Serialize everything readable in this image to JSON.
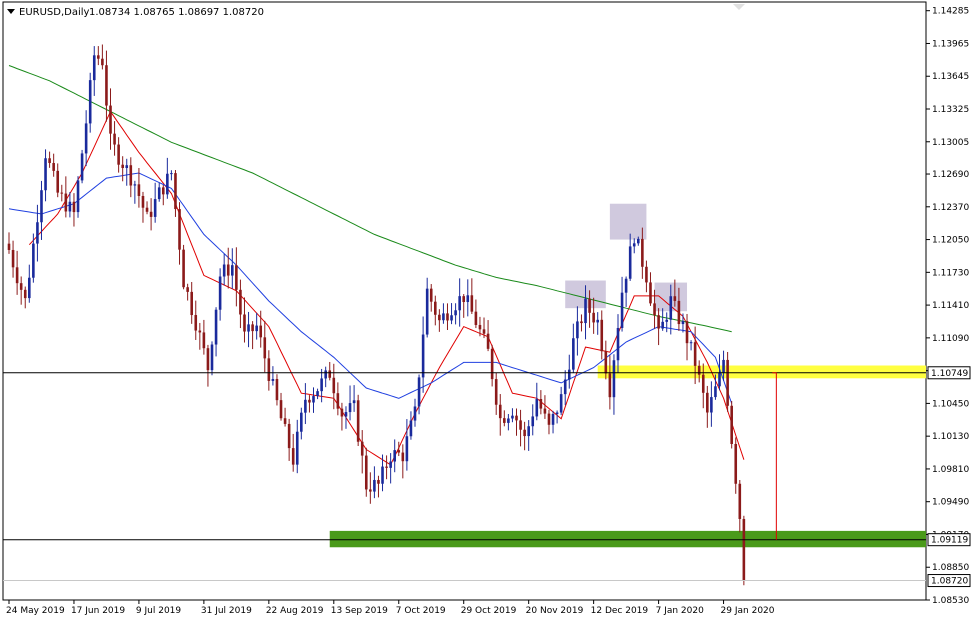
{
  "header": {
    "symbol": "EURUSD,Daily",
    "ohlc": "1.08734 1.08765 1.08697 1.08720"
  },
  "colors": {
    "bull": "#1a2a9c",
    "bear": "#8b1a1a",
    "ma_fast": "#e00000",
    "ma_mid": "#2040e0",
    "ma_slow": "#1a8a1a",
    "support_zone": "#4a9a1a",
    "resistance_zone": "#ffff40",
    "pattern_box": "#c8c0d8",
    "price_tag_bg": "#ffffff"
  },
  "price_tags": {
    "resistance": "1.10749",
    "support": "1.09119",
    "current": "1.08720"
  },
  "chart_data": {
    "type": "candlestick",
    "ylim": [
      1.0853,
      1.1437
    ],
    "y_ticks": [
      "1.14285",
      "1.13965",
      "1.13645",
      "1.13325",
      "1.13005",
      "1.12690",
      "1.12370",
      "1.12050",
      "1.11730",
      "1.11410",
      "1.11090",
      "1.10770",
      "1.10450",
      "1.10130",
      "1.09810",
      "1.09490",
      "1.09170",
      "1.08850",
      "1.08530"
    ],
    "x_labels": [
      "24 May 2019",
      "17 Jun 2019",
      "9 Jul 2019",
      "31 Jul 2019",
      "22 Aug 2019",
      "13 Sep 2019",
      "7 Oct 2019",
      "29 Oct 2019",
      "20 Nov 2019",
      "12 Dec 2019",
      "7 Jan 2020",
      "29 Jan 2020"
    ],
    "x_label_bar_index": [
      0,
      16,
      32,
      48,
      64,
      80,
      96,
      112,
      128,
      144,
      160,
      176
    ],
    "n_bars": 182,
    "close_keyframes": [
      [
        0,
        1.1195
      ],
      [
        4,
        1.1145
      ],
      [
        6,
        1.12
      ],
      [
        9,
        1.129
      ],
      [
        12,
        1.125
      ],
      [
        16,
        1.123
      ],
      [
        19,
        1.132
      ],
      [
        21,
        1.1385
      ],
      [
        23,
        1.138
      ],
      [
        25,
        1.13
      ],
      [
        28,
        1.128
      ],
      [
        31,
        1.126
      ],
      [
        34,
        1.1225
      ],
      [
        37,
        1.125
      ],
      [
        40,
        1.127
      ],
      [
        43,
        1.1165
      ],
      [
        46,
        1.1125
      ],
      [
        49,
        1.108
      ],
      [
        52,
        1.117
      ],
      [
        55,
        1.118
      ],
      [
        58,
        1.111
      ],
      [
        61,
        1.112
      ],
      [
        64,
        1.1075
      ],
      [
        67,
        1.103
      ],
      [
        70,
        1.099
      ],
      [
        73,
        1.105
      ],
      [
        76,
        1.106
      ],
      [
        79,
        1.1075
      ],
      [
        82,
        1.1035
      ],
      [
        85,
        1.104
      ],
      [
        88,
        1.0965
      ],
      [
        91,
        1.0965
      ],
      [
        94,
        1.0995
      ],
      [
        97,
        1.0995
      ],
      [
        100,
        1.1035
      ],
      [
        103,
        1.1155
      ],
      [
        106,
        1.1125
      ],
      [
        109,
        1.114
      ],
      [
        112,
        1.115
      ],
      [
        115,
        1.1125
      ],
      [
        118,
        1.1095
      ],
      [
        121,
        1.103
      ],
      [
        124,
        1.104
      ],
      [
        127,
        1.101
      ],
      [
        130,
        1.105
      ],
      [
        133,
        1.102
      ],
      [
        136,
        1.105
      ],
      [
        139,
        1.1105
      ],
      [
        142,
        1.114
      ],
      [
        145,
        1.1125
      ],
      [
        148,
        1.106
      ],
      [
        151,
        1.1155
      ],
      [
        154,
        1.121
      ],
      [
        157,
        1.117
      ],
      [
        160,
        1.111
      ],
      [
        163,
        1.1145
      ],
      [
        166,
        1.112
      ],
      [
        169,
        1.1085
      ],
      [
        172,
        1.1035
      ],
      [
        175,
        1.107
      ],
      [
        176,
        1.1088
      ],
      [
        178,
        1.101
      ],
      [
        180,
        1.0935
      ],
      [
        181,
        1.0872
      ]
    ],
    "series": [
      {
        "line": "ma_fast",
        "keyframes": [
          [
            5,
            1.12
          ],
          [
            12,
            1.123
          ],
          [
            18,
            1.127
          ],
          [
            25,
            1.133
          ],
          [
            32,
            1.129
          ],
          [
            40,
            1.125
          ],
          [
            48,
            1.117
          ],
          [
            56,
            1.1155
          ],
          [
            64,
            1.112
          ],
          [
            72,
            1.1055
          ],
          [
            80,
            1.105
          ],
          [
            88,
            1.1
          ],
          [
            94,
            1.0985
          ],
          [
            100,
            1.1035
          ],
          [
            106,
            1.108
          ],
          [
            112,
            1.112
          ],
          [
            118,
            1.111
          ],
          [
            124,
            1.1055
          ],
          [
            130,
            1.105
          ],
          [
            136,
            1.103
          ],
          [
            142,
            1.11
          ],
          [
            148,
            1.1095
          ],
          [
            154,
            1.115
          ],
          [
            160,
            1.115
          ],
          [
            166,
            1.113
          ],
          [
            172,
            1.1085
          ],
          [
            176,
            1.105
          ],
          [
            181,
            1.099
          ]
        ]
      },
      {
        "line": "ma_mid",
        "keyframes": [
          [
            0,
            1.1235
          ],
          [
            8,
            1.123
          ],
          [
            16,
            1.124
          ],
          [
            24,
            1.1265
          ],
          [
            32,
            1.127
          ],
          [
            40,
            1.1255
          ],
          [
            48,
            1.121
          ],
          [
            56,
            1.118
          ],
          [
            64,
            1.1145
          ],
          [
            72,
            1.1115
          ],
          [
            80,
            1.109
          ],
          [
            88,
            1.106
          ],
          [
            96,
            1.105
          ],
          [
            104,
            1.1065
          ],
          [
            112,
            1.1085
          ],
          [
            120,
            1.1085
          ],
          [
            128,
            1.1075
          ],
          [
            136,
            1.1065
          ],
          [
            144,
            1.108
          ],
          [
            152,
            1.1105
          ],
          [
            160,
            1.112
          ],
          [
            168,
            1.1115
          ],
          [
            174,
            1.109
          ],
          [
            178,
            1.1045
          ]
        ]
      },
      {
        "line": "ma_slow",
        "keyframes": [
          [
            0,
            1.1375
          ],
          [
            10,
            1.136
          ],
          [
            20,
            1.134
          ],
          [
            30,
            1.132
          ],
          [
            40,
            1.13
          ],
          [
            50,
            1.1285
          ],
          [
            60,
            1.127
          ],
          [
            70,
            1.125
          ],
          [
            80,
            1.123
          ],
          [
            90,
            1.121
          ],
          [
            100,
            1.1195
          ],
          [
            110,
            1.118
          ],
          [
            120,
            1.1168
          ],
          [
            130,
            1.116
          ],
          [
            140,
            1.115
          ],
          [
            150,
            1.114
          ],
          [
            160,
            1.113
          ],
          [
            170,
            1.1122
          ],
          [
            178,
            1.1115
          ]
        ]
      }
    ]
  },
  "annotations": {
    "resistance_level": 1.10749,
    "support_level": 1.09119,
    "support_zone": [
      1.09045,
      1.09205
    ],
    "resistance_zone": [
      1.10695,
      1.1082
    ],
    "support_zone_start_bar": 79,
    "resistance_zone_start_bar": 145,
    "current_price": 1.0872,
    "pattern_boxes": [
      {
        "from_bar": 137,
        "to_bar": 147,
        "low": 1.1138,
        "high": 1.1165
      },
      {
        "from_bar": 148,
        "to_bar": 157,
        "low": 1.1205,
        "high": 1.124
      },
      {
        "from_bar": 159,
        "to_bar": 167,
        "low": 1.1135,
        "high": 1.1163
      }
    ],
    "measure_line": {
      "bar": 189,
      "from": 1.09119,
      "to": 1.10749
    }
  }
}
